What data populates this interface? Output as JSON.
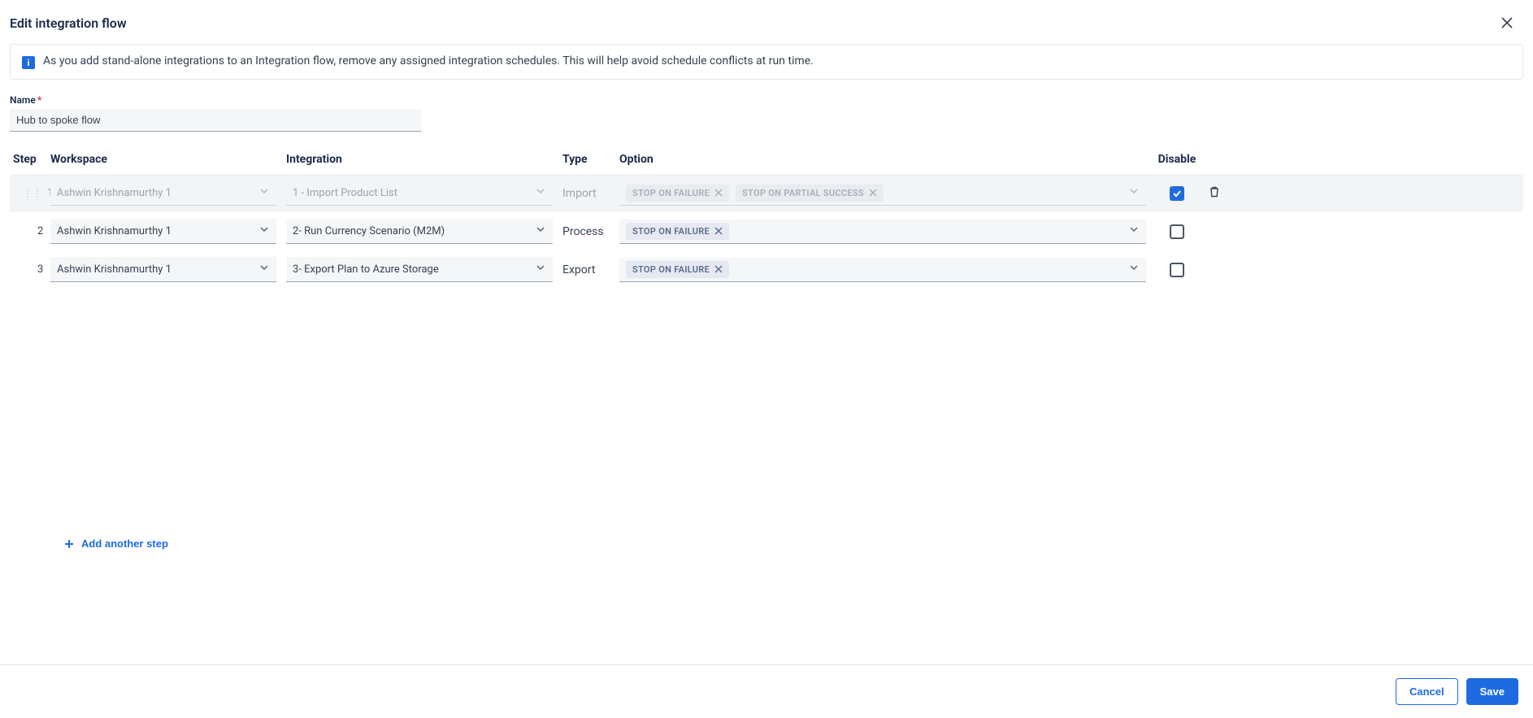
{
  "modal": {
    "title": "Edit integration flow",
    "info_banner": "As you add stand-alone integrations to an Integration flow, remove any assigned integration schedules. This will help avoid schedule conflicts at run time.",
    "name_label": "Name",
    "name_value": "Hub to spoke flow",
    "add_step_label": "Add another step",
    "cancel_label": "Cancel",
    "save_label": "Save"
  },
  "columns": {
    "step": "Step",
    "workspace": "Workspace",
    "integration": "Integration",
    "type": "Type",
    "option": "Option",
    "disable": "Disable"
  },
  "rows": [
    {
      "step": "1",
      "workspace": "Ashwin Krishnamurthy 1",
      "integration": "1 - Import Product List",
      "type": "Import",
      "options": [
        "STOP ON FAILURE",
        "STOP ON PARTIAL SUCCESS"
      ],
      "disabled": true
    },
    {
      "step": "2",
      "workspace": "Ashwin Krishnamurthy 1",
      "integration": "2- Run Currency Scenario (M2M)",
      "type": "Process",
      "options": [
        "STOP ON FAILURE"
      ],
      "disabled": false
    },
    {
      "step": "3",
      "workspace": "Ashwin Krishnamurthy 1",
      "integration": "3- Export Plan to Azure Storage",
      "type": "Export",
      "options": [
        "STOP ON FAILURE"
      ],
      "disabled": false
    }
  ]
}
